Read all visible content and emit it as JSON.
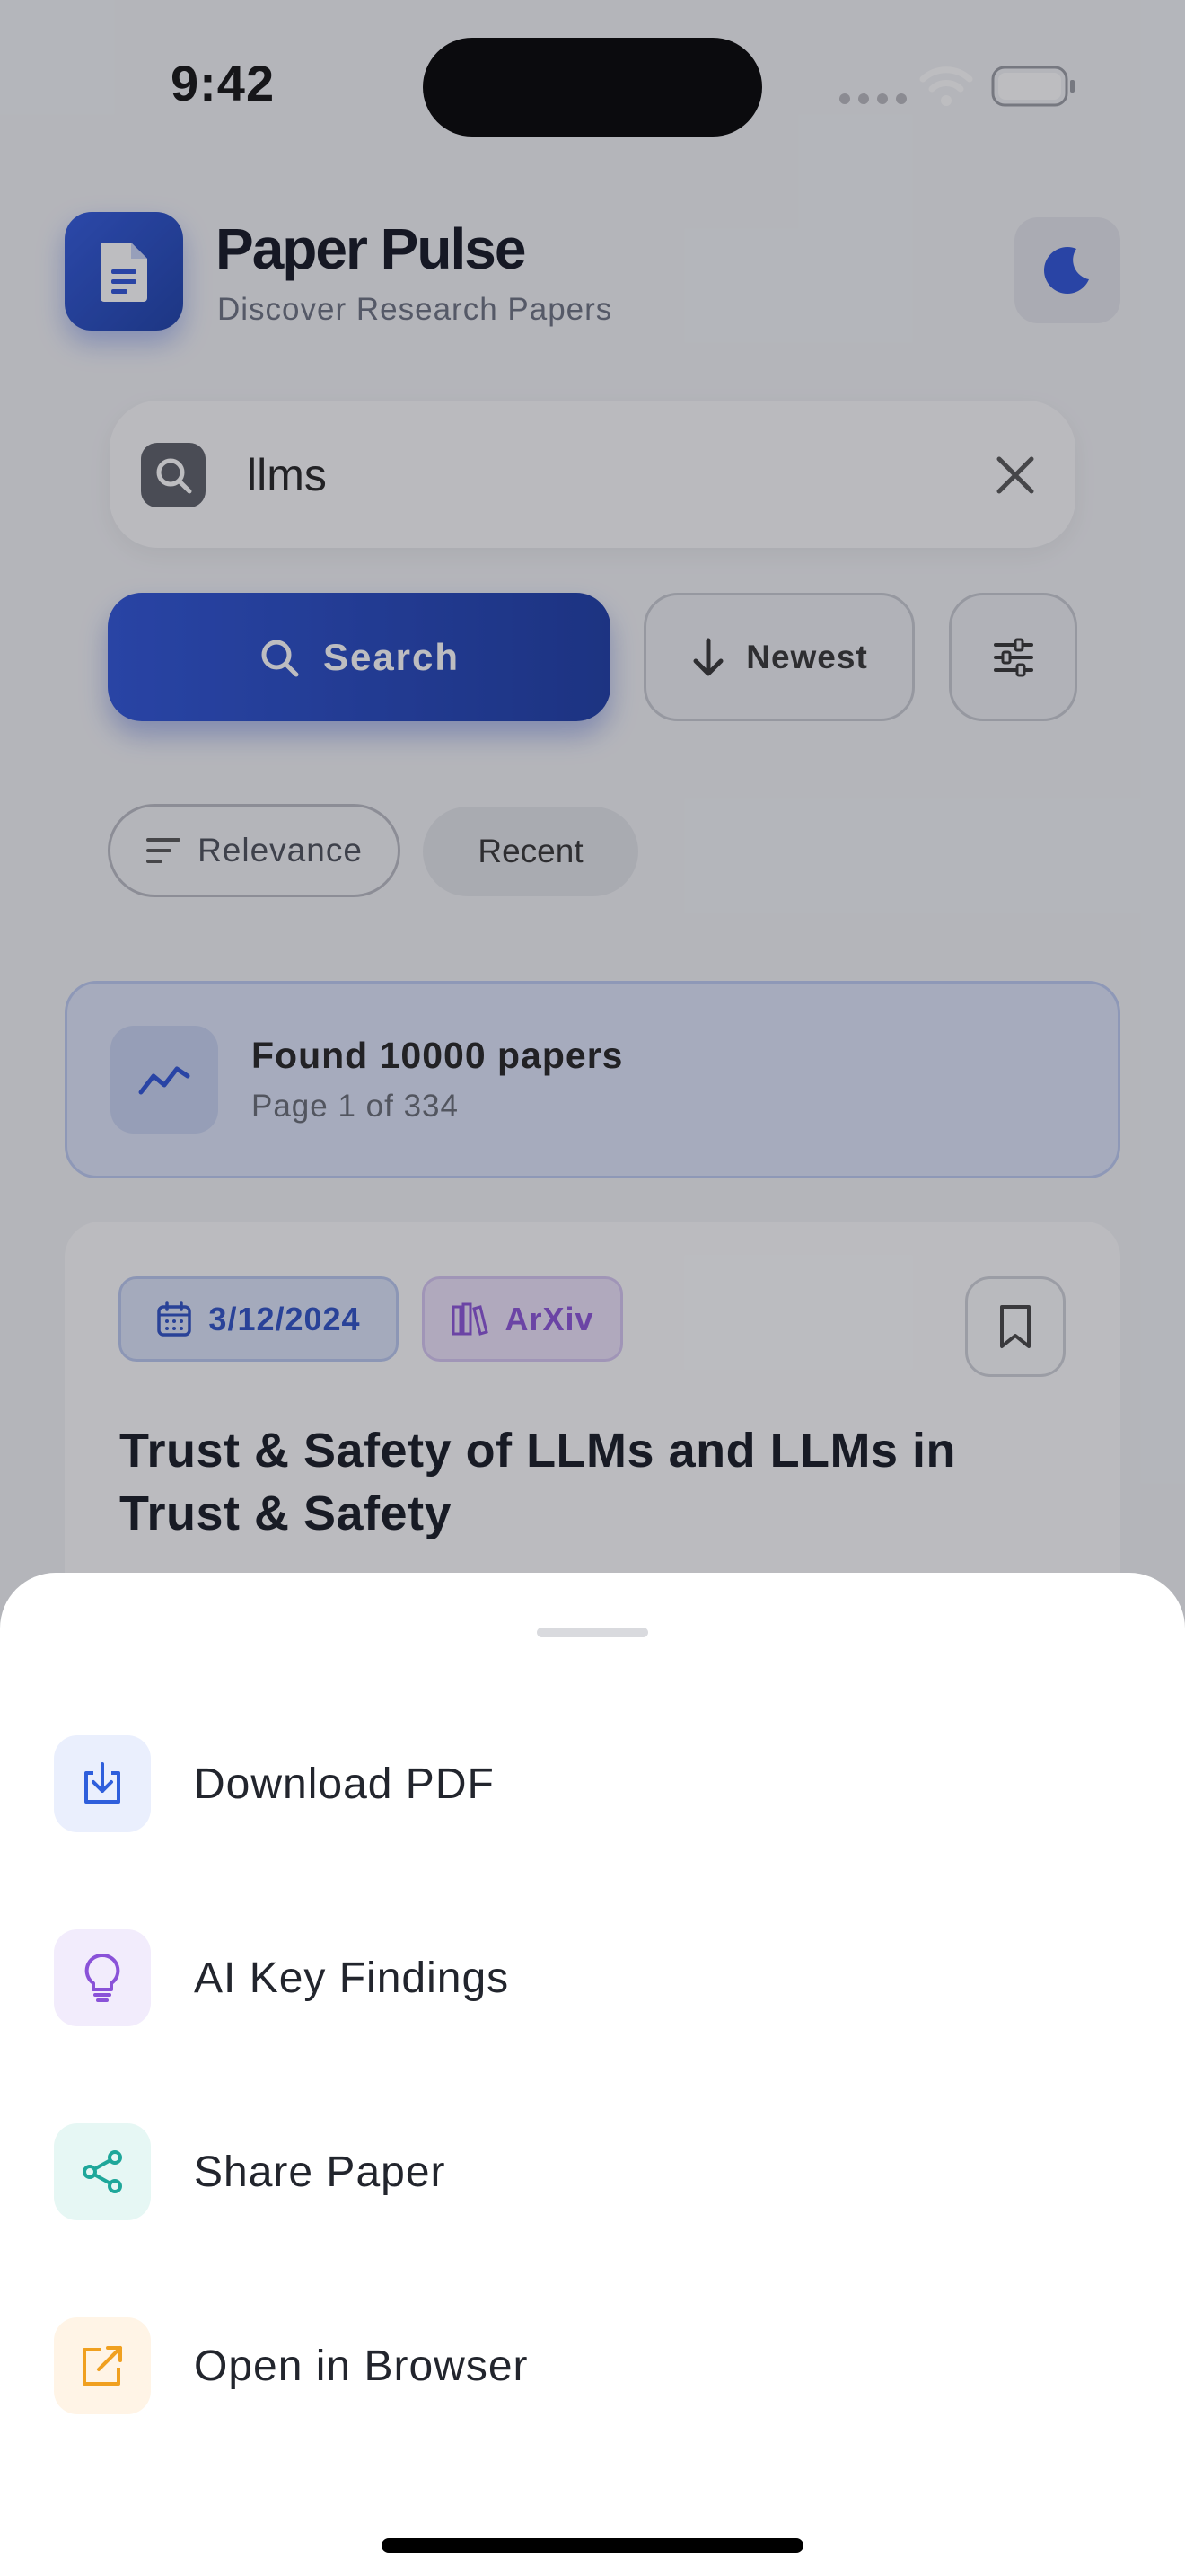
{
  "status_bar": {
    "time": "9:42"
  },
  "header": {
    "title": "Paper Pulse",
    "subtitle": "Discover Research Papers"
  },
  "search": {
    "query": "llms",
    "button_label": "Search",
    "sort_label": "Newest"
  },
  "chips": {
    "relevance": "Relevance",
    "recent": "Recent"
  },
  "results": {
    "found": "Found 10000 papers",
    "page": "Page 1 of 334"
  },
  "paper": {
    "date": "3/12/2024",
    "source": "ArXiv",
    "title": "Trust & Safety of LLMs and LLMs in Trust & Safety"
  },
  "sheet": {
    "actions": [
      {
        "label": "Download PDF",
        "icon": "download-icon",
        "color": "#2f5fdc",
        "bg": "#eaeffd"
      },
      {
        "label": "AI Key Findings",
        "icon": "lightbulb-icon",
        "color": "#8a52d8",
        "bg": "#f2ecfc"
      },
      {
        "label": "Share Paper",
        "icon": "share-icon",
        "color": "#1fa79a",
        "bg": "#e6f7f4"
      },
      {
        "label": "Open in Browser",
        "icon": "external-link-icon",
        "color": "#f0a020",
        "bg": "#fff4e6"
      }
    ]
  },
  "colors": {
    "primary": "#2b52d8",
    "accent_purple": "#8a52d8",
    "accent_teal": "#1fa79a",
    "accent_orange": "#f0a020"
  }
}
